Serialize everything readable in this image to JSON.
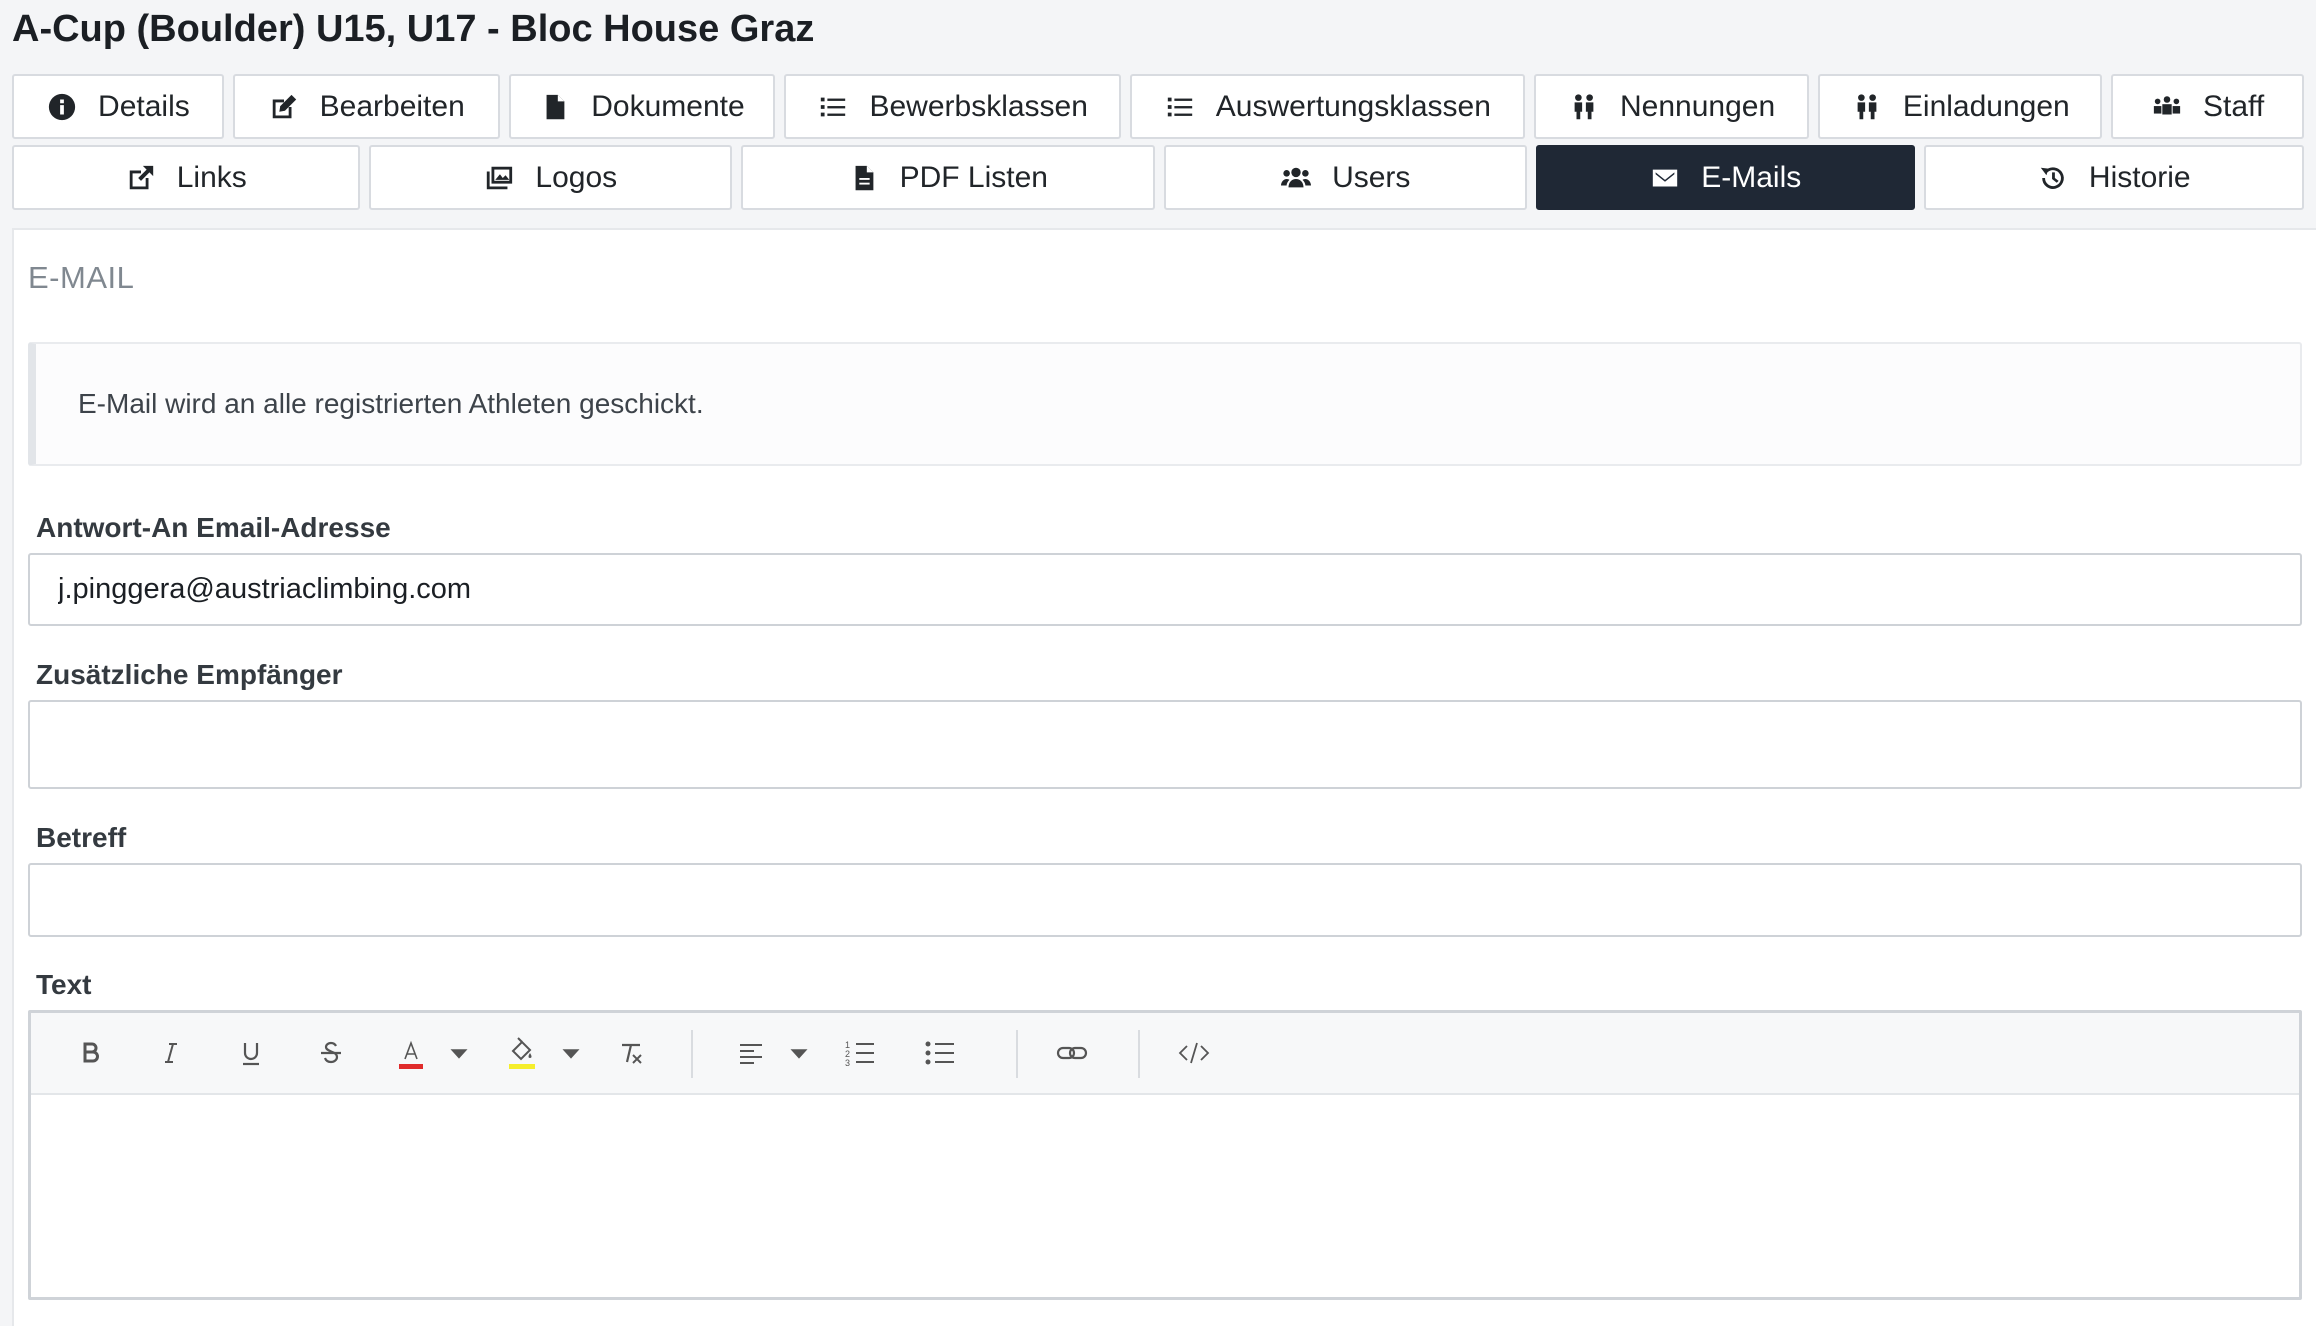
{
  "page": {
    "title": "A-Cup (Boulder) U15, U17 - Bloc House Graz"
  },
  "tabs_row1": [
    {
      "label": "Details",
      "icon": "info-circle-icon"
    },
    {
      "label": "Bearbeiten",
      "icon": "edit-icon"
    },
    {
      "label": "Dokumente",
      "icon": "file-icon"
    },
    {
      "label": "Bewerbsklassen",
      "icon": "list-icon"
    },
    {
      "label": "Auswertungsklassen",
      "icon": "list-icon"
    },
    {
      "label": "Nennungen",
      "icon": "people-icon"
    },
    {
      "label": "Einladungen",
      "icon": "people-icon"
    },
    {
      "label": "Staff",
      "icon": "group-icon"
    }
  ],
  "tabs_row2": [
    {
      "label": "Links",
      "icon": "external-link-icon"
    },
    {
      "label": "Logos",
      "icon": "images-icon"
    },
    {
      "label": "PDF Listen",
      "icon": "file-icon"
    },
    {
      "label": "Users",
      "icon": "users-icon"
    },
    {
      "label": "E-Mails",
      "icon": "envelope-icon",
      "active": true
    },
    {
      "label": "Historie",
      "icon": "history-icon"
    }
  ],
  "section": {
    "title": "E-MAIL",
    "info_text": "E-Mail wird an alle registrierten Athleten geschickt."
  },
  "form": {
    "reply_to": {
      "label": "Antwort-An Email-Adresse",
      "value": "j.pinggera@austriaclimbing.com"
    },
    "extra_recipients": {
      "label": "Zusätzliche Empfänger",
      "value": ""
    },
    "subject": {
      "label": "Betreff",
      "value": ""
    },
    "text": {
      "label": "Text",
      "value": ""
    }
  },
  "editor_toolbar": [
    "bold-icon",
    "italic-icon",
    "underline-icon",
    "strikethrough-icon",
    "font-color-icon",
    "dropdown-caret-icon",
    "highlight-color-icon",
    "dropdown-caret-icon",
    "clear-format-icon",
    "align-left-icon",
    "dropdown-caret-icon",
    "ordered-list-icon",
    "unordered-list-icon",
    "link-icon",
    "code-view-icon"
  ],
  "colors": {
    "active_tab": "#1f2835",
    "font_color_swatch": "#e02b2b",
    "highlight_swatch": "#f5ee2c"
  }
}
